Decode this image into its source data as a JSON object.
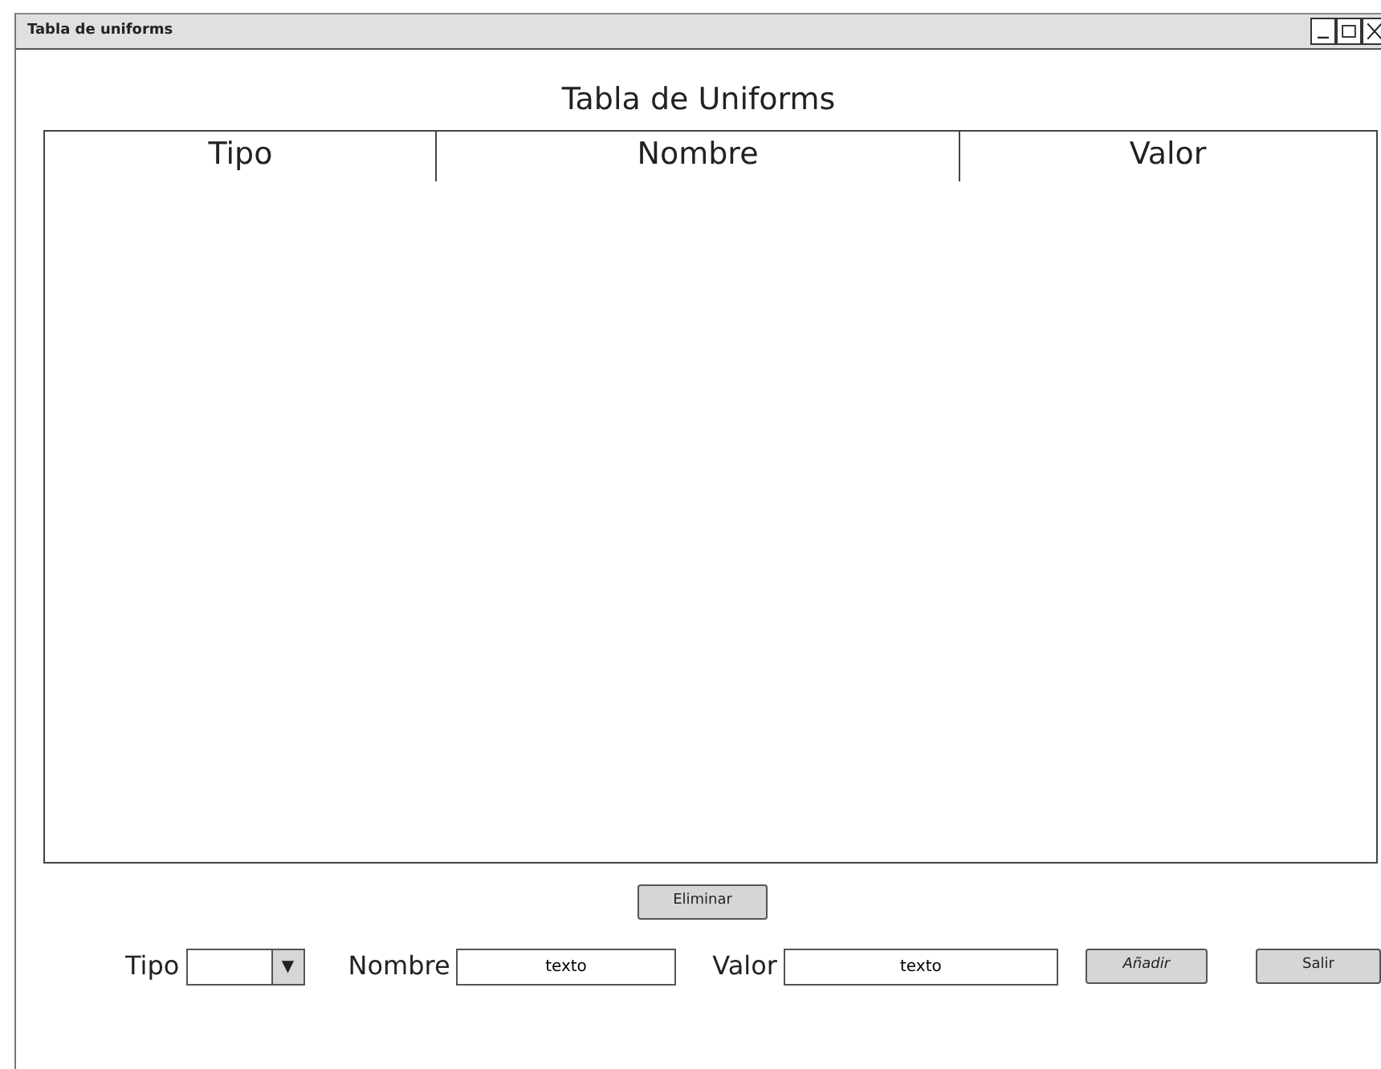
{
  "window": {
    "title": "Tabla de uniforms"
  },
  "heading": "Tabla de Uniforms",
  "table": {
    "columns": [
      "Tipo",
      "Nombre",
      "Valor"
    ]
  },
  "delete_button": "Eliminar",
  "form": {
    "fields": [
      {
        "kind": "select",
        "label": "Tipo",
        "arrow": "▼"
      },
      {
        "kind": "text",
        "label": "Nombre",
        "value": "texto"
      },
      {
        "kind": "text",
        "label": "Valor",
        "value": "texto"
      }
    ],
    "buttons": [
      "Añadir",
      "Salir"
    ]
  }
}
